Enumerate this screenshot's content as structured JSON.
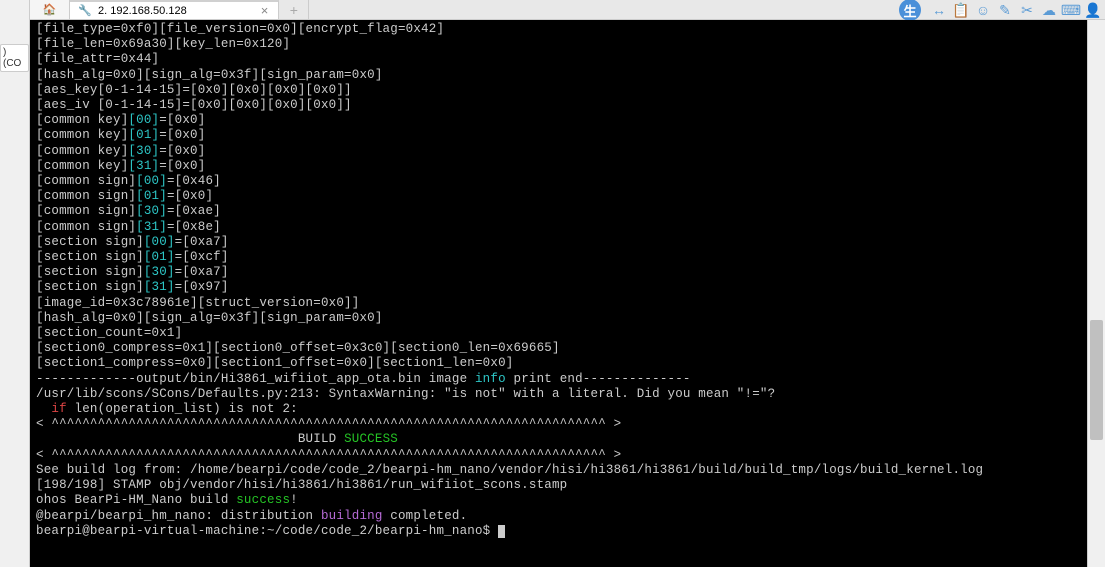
{
  "left": {
    "badge_text": ") (CO"
  },
  "tabs": {
    "active_label": "2. 192.168.50.128",
    "close_glyph": "×",
    "new_glyph": "+"
  },
  "terminal": {
    "lines": [
      {
        "segs": [
          {
            "t": "[file_type=0xf0][file_version=0x0][encrypt_flag=0x42]"
          }
        ]
      },
      {
        "segs": [
          {
            "t": "[file_len=0x69a30][key_len=0x120]"
          }
        ]
      },
      {
        "segs": [
          {
            "t": "[file_attr=0x44]"
          }
        ]
      },
      {
        "segs": [
          {
            "t": "[hash_alg=0x0][sign_alg=0x3f][sign_param=0x0]"
          }
        ]
      },
      {
        "segs": [
          {
            "t": "[aes_key[0-1-14-15]=[0x0][0x0][0x0][0x0]]"
          }
        ]
      },
      {
        "segs": [
          {
            "t": "[aes_iv [0-1-14-15]=[0x0][0x0][0x0][0x0]]"
          }
        ]
      },
      {
        "segs": [
          {
            "t": "[common key]"
          },
          {
            "t": "[00]",
            "c": "hl-cyan"
          },
          {
            "t": "=[0x0]"
          }
        ]
      },
      {
        "segs": [
          {
            "t": "[common key]"
          },
          {
            "t": "[01]",
            "c": "hl-cyan"
          },
          {
            "t": "=[0x0]"
          }
        ]
      },
      {
        "segs": [
          {
            "t": "[common key]"
          },
          {
            "t": "[30]",
            "c": "hl-cyan"
          },
          {
            "t": "=[0x0]"
          }
        ]
      },
      {
        "segs": [
          {
            "t": "[common key]"
          },
          {
            "t": "[31]",
            "c": "hl-cyan"
          },
          {
            "t": "=[0x0]"
          }
        ]
      },
      {
        "segs": [
          {
            "t": "[common sign]"
          },
          {
            "t": "[00]",
            "c": "hl-cyan"
          },
          {
            "t": "=[0x46]"
          }
        ]
      },
      {
        "segs": [
          {
            "t": "[common sign]"
          },
          {
            "t": "[01]",
            "c": "hl-cyan"
          },
          {
            "t": "=[0x0]"
          }
        ]
      },
      {
        "segs": [
          {
            "t": "[common sign]"
          },
          {
            "t": "[30]",
            "c": "hl-cyan"
          },
          {
            "t": "=[0xae]"
          }
        ]
      },
      {
        "segs": [
          {
            "t": "[common sign]"
          },
          {
            "t": "[31]",
            "c": "hl-cyan"
          },
          {
            "t": "=[0x8e]"
          }
        ]
      },
      {
        "segs": [
          {
            "t": "[section sign]"
          },
          {
            "t": "[00]",
            "c": "hl-cyan"
          },
          {
            "t": "=[0xa7]"
          }
        ]
      },
      {
        "segs": [
          {
            "t": "[section sign]"
          },
          {
            "t": "[01]",
            "c": "hl-cyan"
          },
          {
            "t": "=[0xcf]"
          }
        ]
      },
      {
        "segs": [
          {
            "t": "[section sign]"
          },
          {
            "t": "[30]",
            "c": "hl-cyan"
          },
          {
            "t": "=[0xa7]"
          }
        ]
      },
      {
        "segs": [
          {
            "t": "[section sign]"
          },
          {
            "t": "[31]",
            "c": "hl-cyan"
          },
          {
            "t": "=[0x97]"
          }
        ]
      },
      {
        "segs": [
          {
            "t": "[image_id=0x3c78961e][struct_version=0x0]]"
          }
        ]
      },
      {
        "segs": [
          {
            "t": "[hash_alg=0x0][sign_alg=0x3f][sign_param=0x0]"
          }
        ]
      },
      {
        "segs": [
          {
            "t": "[section_count=0x1]"
          }
        ]
      },
      {
        "segs": [
          {
            "t": "[section0_compress=0x1][section0_offset=0x3c0][section0_len=0x69665]"
          }
        ]
      },
      {
        "segs": [
          {
            "t": "[section1_compress=0x0][section1_offset=0x0][section1_len=0x0]"
          }
        ]
      },
      {
        "segs": [
          {
            "t": "-------------output/bin/Hi3861_wifiiot_app_ota.bin image "
          },
          {
            "t": "info",
            "c": "hl-cyan"
          },
          {
            "t": " print end--------------"
          }
        ]
      },
      {
        "segs": [
          {
            "t": "/usr/lib/scons/SCons/Defaults.py:213: SyntaxWarning: \"is not\" with a literal. Did you mean \"!=\"?"
          }
        ]
      },
      {
        "segs": [
          {
            "t": "  "
          },
          {
            "t": "if",
            "c": "hl-red"
          },
          {
            "t": " len(operation_list) is not 2:"
          }
        ]
      },
      {
        "segs": [
          {
            "t": ""
          }
        ]
      },
      {
        "segs": [
          {
            "t": "< ^^^^^^^^^^^^^^^^^^^^^^^^^^^^^^^^^^^^^^^^^^^^^^^^^^^^^^^^^^^^^^^^^^^^^^^^ >"
          }
        ]
      },
      {
        "segs": [
          {
            "t": "                                  BUILD "
          },
          {
            "t": "SUCCESS",
            "c": "hl-green"
          }
        ]
      },
      {
        "segs": [
          {
            "t": "< ^^^^^^^^^^^^^^^^^^^^^^^^^^^^^^^^^^^^^^^^^^^^^^^^^^^^^^^^^^^^^^^^^^^^^^^^ >"
          }
        ]
      },
      {
        "segs": [
          {
            "t": ""
          }
        ]
      },
      {
        "segs": [
          {
            "t": "See build log from: /home/bearpi/code/code_2/bearpi-hm_nano/vendor/hisi/hi3861/hi3861/build/build_tmp/logs/build_kernel.log"
          }
        ]
      },
      {
        "segs": [
          {
            "t": "[198/198] STAMP obj/vendor/hisi/hi3861/hi3861/run_wifiiot_scons.stamp"
          }
        ]
      },
      {
        "segs": [
          {
            "t": "ohos BearPi-HM_Nano build "
          },
          {
            "t": "success",
            "c": "hl-green"
          },
          {
            "t": "!"
          }
        ]
      },
      {
        "segs": [
          {
            "t": "@bearpi/bearpi_hm_nano: distribution "
          },
          {
            "t": "building",
            "c": "hl-purple"
          },
          {
            "t": " completed."
          }
        ]
      },
      {
        "segs": [
          {
            "t": "bearpi@bearpi-virtual-machine:~/code/code_2/bearpi-hm_nano$ "
          }
        ],
        "cursor": true
      }
    ]
  },
  "icons": {
    "home": "🏠",
    "terminal": "🔧",
    "round_badge": "生",
    "i1": "↔",
    "i2": "📋",
    "i3": "☺",
    "i4": "✎",
    "i5": "✂",
    "i6": "☁",
    "i7": "⌨",
    "i8": "👤"
  }
}
